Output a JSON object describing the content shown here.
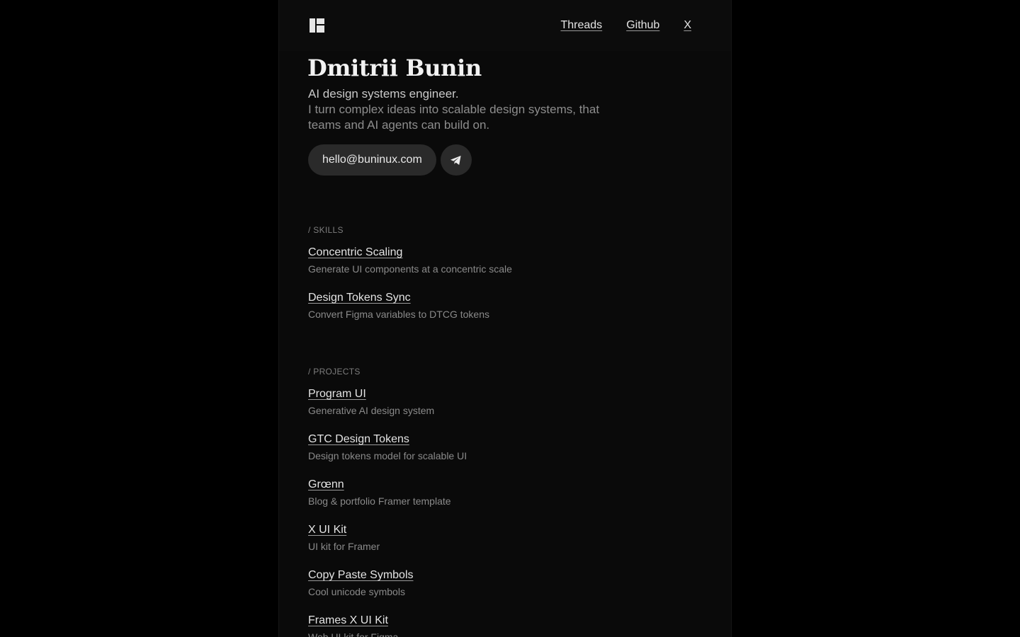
{
  "header": {
    "logo_icon": "layout-logo-icon",
    "nav": [
      "Threads",
      "Github",
      "X"
    ]
  },
  "profile": {
    "name": "Dmitrii Bunin",
    "role": "AI design systems engineer.",
    "description": "I turn complex ideas into scalable design systems, that teams and AI agents can build on.",
    "email": "hello@buninux.com",
    "telegram_icon": "telegram-icon"
  },
  "skills": {
    "label": "/ SKILLS",
    "items": [
      {
        "title": "Concentric Scaling",
        "subtitle": "Generate UI components at a concentric scale"
      },
      {
        "title": "Design Tokens Sync",
        "subtitle": "Convert Figma variables to DTCG tokens"
      }
    ]
  },
  "projects": {
    "label": "/ PROJECTS",
    "items": [
      {
        "title": "Program UI",
        "subtitle": "Generative AI design system"
      },
      {
        "title": "GTC Design Tokens",
        "subtitle": "Design tokens model for scalable UI"
      },
      {
        "title": "Grœnn",
        "subtitle": "Blog & portfolio Framer template"
      },
      {
        "title": "X UI Kit",
        "subtitle": "UI kit for Framer"
      },
      {
        "title": "Copy Paste Symbols",
        "subtitle": "Cool unicode symbols"
      },
      {
        "title": "Frames X UI Kit",
        "subtitle": "Web UI kit for Figma"
      }
    ]
  },
  "colors": {
    "page_bg": "#000000",
    "column_bg": "#0a0a0a",
    "button_bg": "#2a2a2a",
    "text_primary": "#e4e4e4",
    "text_muted": "#8a8a8a"
  }
}
